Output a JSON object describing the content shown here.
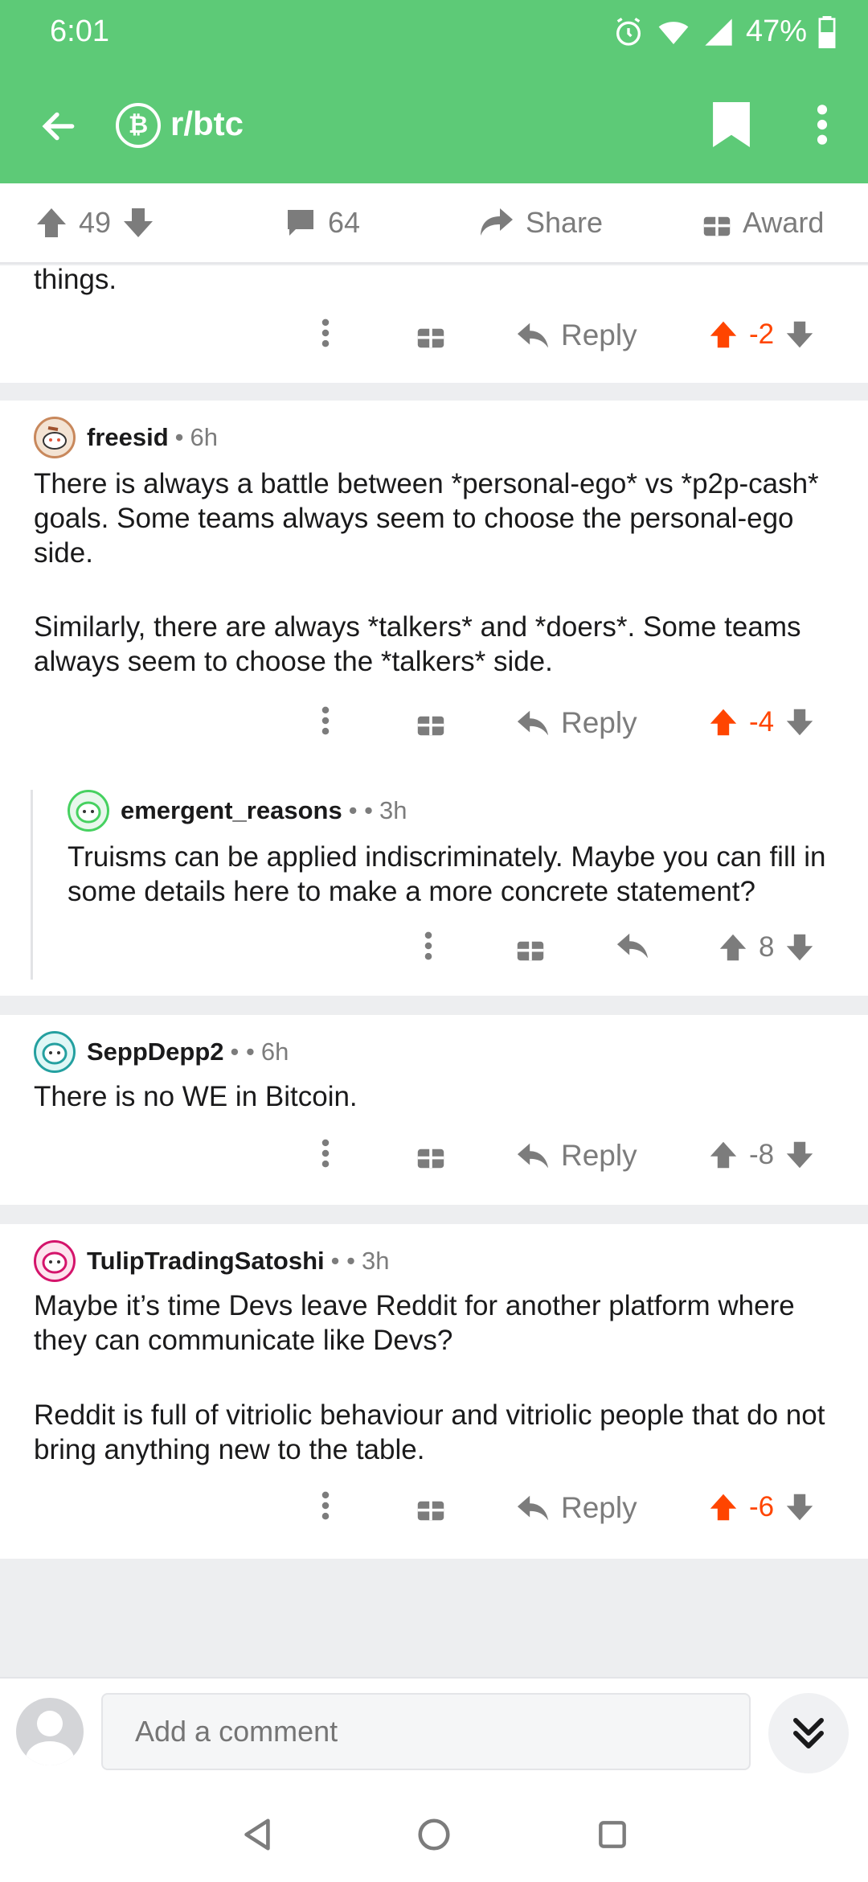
{
  "status_bar": {
    "time": "6:01",
    "battery": "47%"
  },
  "toolbar": {
    "subreddit": "r/btc",
    "sub_icon_glyph": "₿"
  },
  "post_actions": {
    "upvotes": "49",
    "comments": "64",
    "share": "Share",
    "award": "Award"
  },
  "colors": {
    "brand_green": "#5dca77",
    "upvote_orange": "#ff4500",
    "text_gray": "#7c7c7c"
  },
  "partial_comment": {
    "text": "things.",
    "reply": "Reply",
    "score": "-2"
  },
  "comments": [
    {
      "user": "freesid",
      "sep": "•",
      "age": "6h",
      "paragraphs": [
        "There is always a battle between *personal-ego* vs *p2p-cash* goals.  Some teams always seem to choose the personal-ego side.",
        "Similarly, there are always *talkers* and *doers*. Some teams always seem to choose the *talkers* side."
      ],
      "reply": "Reply",
      "score": "-4"
    },
    {
      "user": "emergent_reasons",
      "sep": "• • ",
      "age": "3h",
      "paragraphs": [
        "Truisms can be applied indiscriminately. Maybe you can fill in some details here to make a more concrete statement?"
      ],
      "score": "8"
    },
    {
      "user": "SeppDepp2",
      "sep": "• • ",
      "age": "6h",
      "paragraphs": [
        "There is no WE in Bitcoin."
      ],
      "reply": "Reply",
      "score": "-8"
    },
    {
      "user": "TulipTradingSatoshi",
      "sep": "• • ",
      "age": "3h",
      "paragraphs": [
        "Maybe it’s time Devs leave Reddit for another platform where they can communicate like Devs?",
        "Reddit is full of vitriolic behaviour and vitriolic people that do not bring anything new to the table."
      ],
      "reply": "Reply",
      "score": "-6"
    }
  ],
  "bottom_bar": {
    "placeholder": "Add a comment"
  },
  "icons": [
    "back-arrow-icon",
    "bitcoin-icon",
    "bookmark-icon",
    "more-vertical-icon",
    "upvote-icon",
    "downvote-icon",
    "comment-icon",
    "share-icon",
    "award-icon",
    "reply-icon",
    "gift-icon",
    "chevron-double-down-icon",
    "nav-back-icon",
    "nav-home-icon",
    "nav-recents-icon"
  ]
}
